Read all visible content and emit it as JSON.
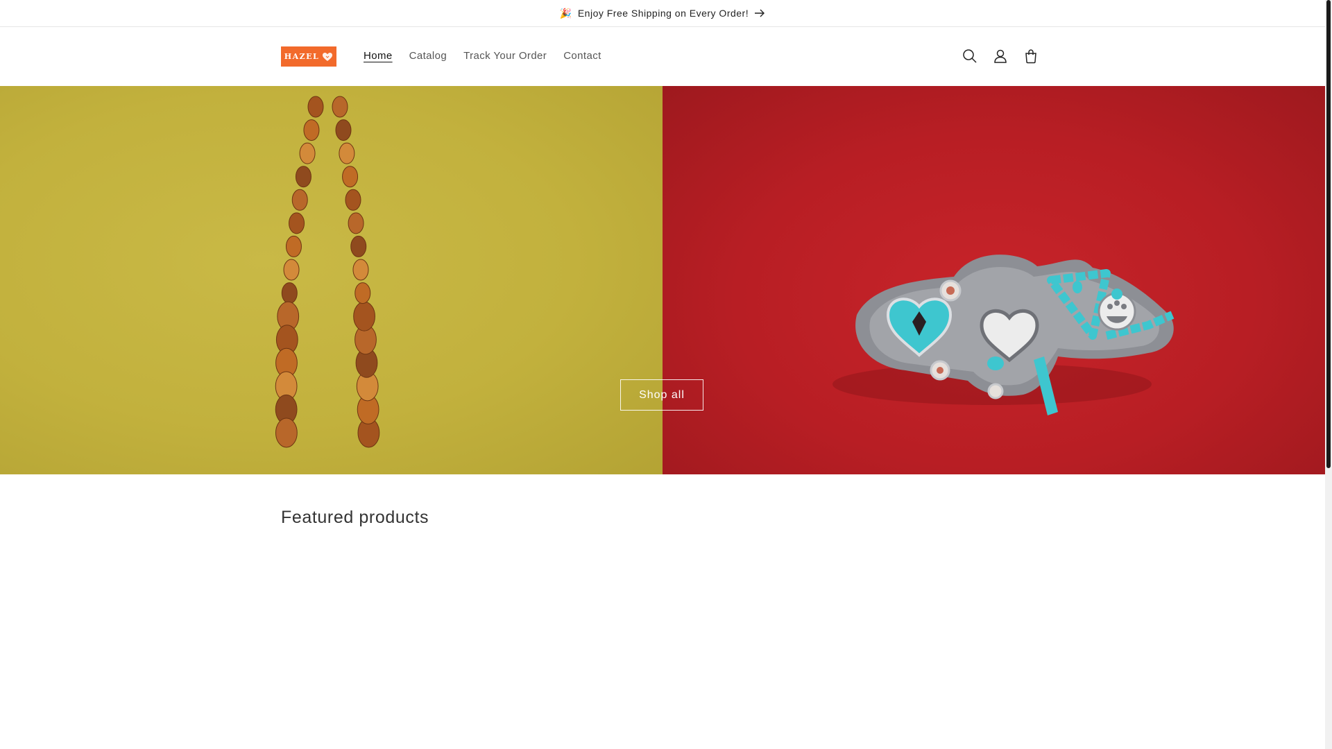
{
  "announcement": {
    "emoji": "🎉",
    "text": "Enjoy Free Shipping on Every Order!",
    "icon": "arrow-right-icon"
  },
  "header": {
    "logo": {
      "text": "HAZEL",
      "icon": "heart-icon",
      "color": "#f26a2b"
    },
    "nav": [
      {
        "label": "Home",
        "active": true
      },
      {
        "label": "Catalog",
        "active": false
      },
      {
        "label": "Track Your Order",
        "active": false
      },
      {
        "label": "Contact",
        "active": false
      }
    ],
    "icons": [
      "search-icon",
      "account-icon",
      "cart-icon"
    ]
  },
  "hero": {
    "left_image": "amber-bead-necklace-on-yellow",
    "right_image": "turquoise-silver-brooch-on-red",
    "left_bg": "#c2b13d",
    "right_bg": "#b81e24",
    "button_label": "Shop all"
  },
  "featured": {
    "title": "Featured products"
  }
}
